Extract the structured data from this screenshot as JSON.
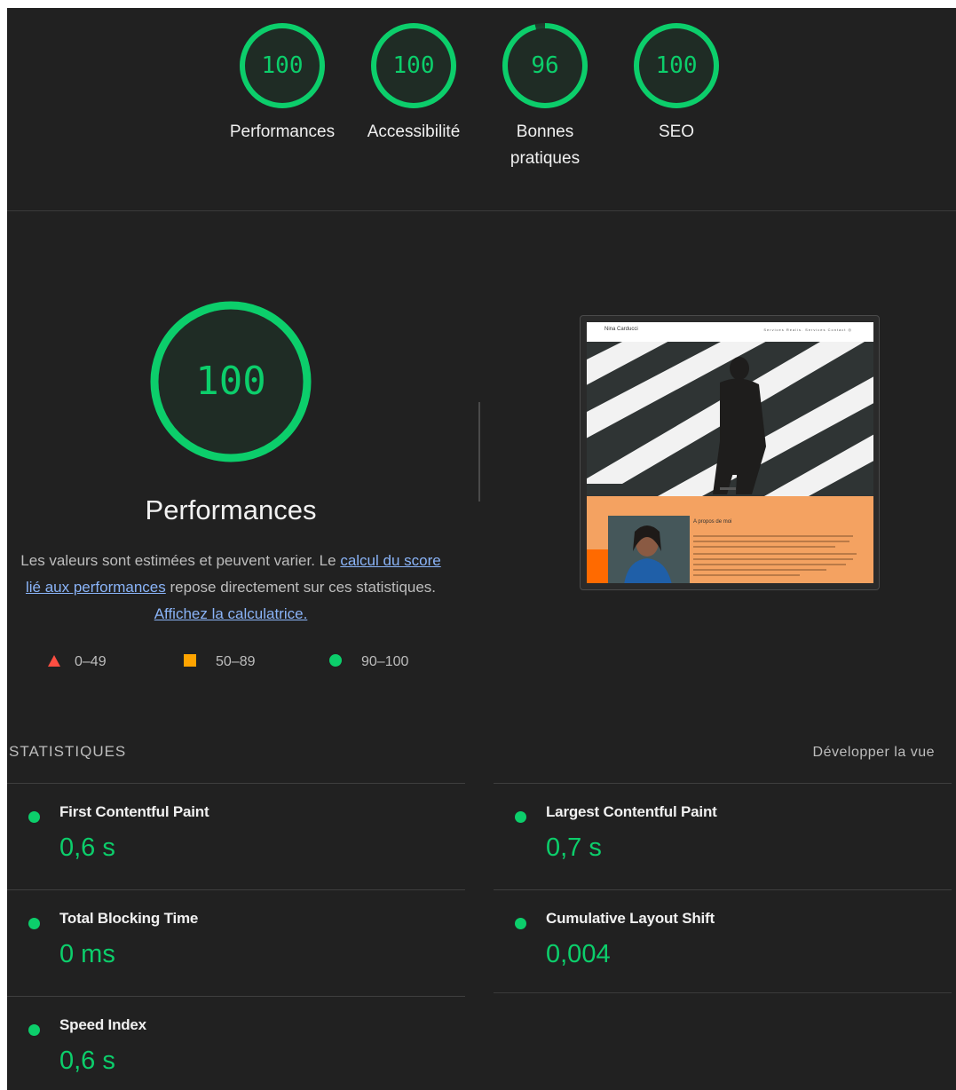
{
  "colors": {
    "pass": "#0cce6b",
    "average": "#ffa400",
    "fail": "#ff4e42",
    "background": "#212121",
    "link": "#8ab4f8"
  },
  "categories": [
    {
      "score": "100",
      "value": 100,
      "label": "Performances"
    },
    {
      "score": "100",
      "value": 100,
      "label": "Accessibilité"
    },
    {
      "score": "96",
      "value": 96,
      "label": "Bonnes pratiques"
    },
    {
      "score": "100",
      "value": 100,
      "label": "SEO"
    }
  ],
  "performance": {
    "score": "100",
    "value": 100,
    "title": "Performances",
    "desc_prefix": "Les valeurs sont estimées et peuvent varier. Le ",
    "desc_link1": "calcul du score lié aux performances",
    "desc_middle": " repose directement sur ces statistiques. ",
    "desc_link2": "Affichez la calculatrice.",
    "legend": [
      {
        "shape": "triangle",
        "range": "0–49"
      },
      {
        "shape": "square",
        "range": "50–89"
      },
      {
        "shape": "circle",
        "range": "90–100"
      }
    ]
  },
  "thumbnail": {
    "brand": "Nina Carducci",
    "menu": "Services  Réalis.  Services  Contact  ◎",
    "about_title": "A propos de moi"
  },
  "stats": {
    "heading": "STATISTIQUES",
    "expand_label": "Développer la vue",
    "metrics": [
      {
        "name": "First Contentful Paint",
        "value": "0,6 s"
      },
      {
        "name": "Largest Contentful Paint",
        "value": "0,7 s"
      },
      {
        "name": "Total Blocking Time",
        "value": "0 ms"
      },
      {
        "name": "Cumulative Layout Shift",
        "value": "0,004"
      },
      {
        "name": "Speed Index",
        "value": "0,6 s"
      }
    ]
  }
}
